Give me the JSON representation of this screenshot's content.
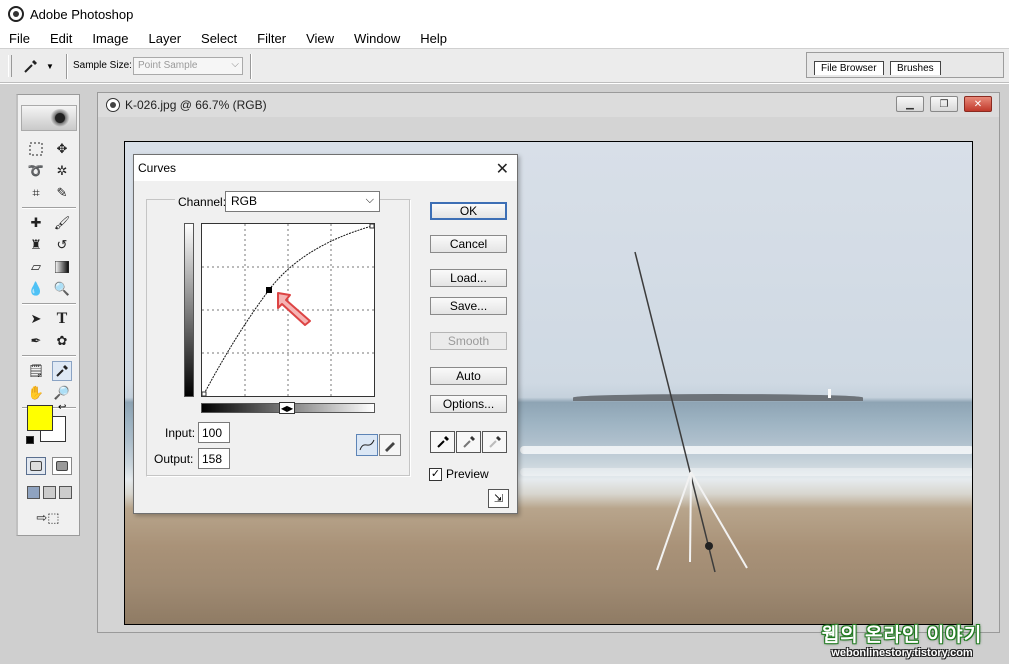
{
  "app": {
    "title": "Adobe Photoshop"
  },
  "menu": [
    "File",
    "Edit",
    "Image",
    "Layer",
    "Select",
    "Filter",
    "View",
    "Window",
    "Help"
  ],
  "options_bar": {
    "sample_size_label": "Sample Size:",
    "sample_size_value": "Point Sample",
    "palette_tabs": [
      "File Browser",
      "Brushes"
    ]
  },
  "toolbox": {
    "foreground_color": "#ffff00",
    "background_color": "#ffffff",
    "active_tool": "eyedropper"
  },
  "document": {
    "title": "K-026.jpg @ 66.7% (RGB)"
  },
  "curves_dialog": {
    "title": "Curves",
    "channel_label": "Channel:",
    "channel_value": "RGB",
    "input_label": "Input:",
    "input_value": "100",
    "output_label": "Output:",
    "output_value": "158",
    "buttons": {
      "ok": "OK",
      "cancel": "Cancel",
      "load": "Load...",
      "save": "Save...",
      "smooth": "Smooth",
      "auto": "Auto",
      "options": "Options..."
    },
    "preview_label": "Preview",
    "preview_checked": true,
    "curve_point": {
      "input": 100,
      "output": 158
    }
  },
  "watermark": {
    "korean": "웹의 온라인 이야기",
    "url": "webonlinestory.tistory.com"
  }
}
